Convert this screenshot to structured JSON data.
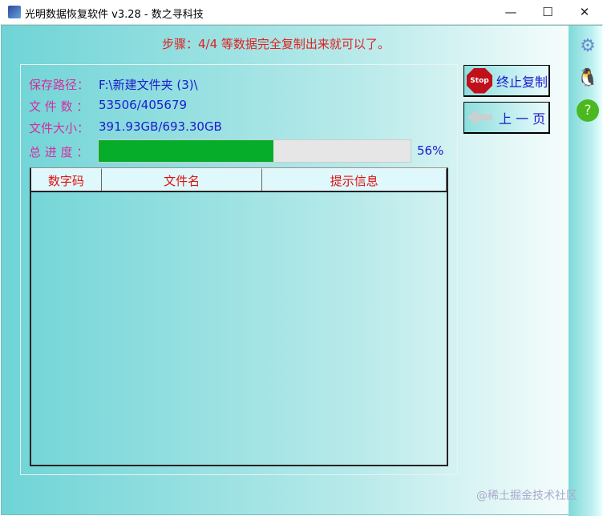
{
  "window": {
    "title": "光明数据恢复软件 v3.28 - 数之寻科技",
    "minimize": "—",
    "maximize": "☐",
    "close": "✕"
  },
  "step": "步骤：4/4 等数据完全复制出来就可以了。",
  "info": {
    "path_label": "保存路径：",
    "path_value": "F:\\新建文件夹 (3)\\",
    "count_label": "文 件 数 ：",
    "count_value": "53506/405679",
    "size_label": "文件大小：",
    "size_value": "391.93GB/693.30GB",
    "progress_label": "总 进 度 ：",
    "progress_percent": 56,
    "progress_text": "56%"
  },
  "table": {
    "columns": [
      "数字码",
      "文件名",
      "提示信息"
    ],
    "rows": []
  },
  "buttons": {
    "stop": "终止复制",
    "stop_icon_text": "Stop",
    "back": "上 一 页"
  },
  "watermark": "@稀土掘金技术社区"
}
